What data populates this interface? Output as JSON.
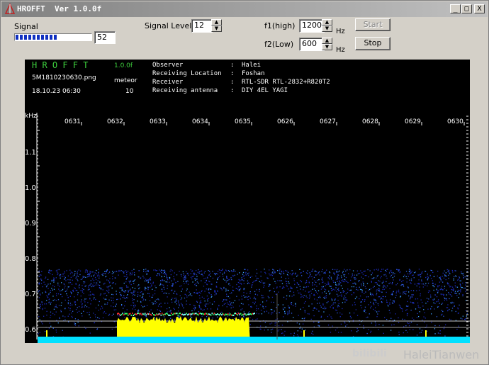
{
  "window": {
    "title": "HROFFT  Ver 1.0.0f",
    "min": "_",
    "max": "□",
    "close": "X"
  },
  "controls": {
    "signal_label": "Signal",
    "signal_value": "52",
    "signal_level": 0.55,
    "signal_level_label": "Signal Level",
    "signal_level_value": "12",
    "f1_label": "f1(high)",
    "f1_value": "1200",
    "f1_unit": "Hz",
    "f2_label": "f2(Low)",
    "f2_value": "600",
    "f2_unit": "Hz",
    "start_label": "Start",
    "stop_label": "Stop"
  },
  "display": {
    "app_name": "H R O F F T",
    "version": "1.0.0f",
    "filename": "5M1810230630.png",
    "mode": "meteor",
    "datetime": "18.10.23 06:30",
    "count": "10",
    "info": [
      {
        "k": "Observer",
        "v": "Halei"
      },
      {
        "k": "Receiving Location",
        "v": "Foshan"
      },
      {
        "k": "Receiver",
        "v": "RTL-SDR RTL-2832+R820T2"
      },
      {
        "k": "Receiving antenna",
        "v": "DIY 4EL YAGI"
      }
    ],
    "time_labels": [
      "0631",
      "0632",
      "0633",
      "0634",
      "0635",
      "0626",
      "0627",
      "0628",
      "0629",
      "0630"
    ],
    "y_unit": "kHz",
    "y_labels": [
      "1.1",
      "1.0",
      "0.9",
      "0.8",
      "0.7",
      "0.6"
    ]
  },
  "watermark": {
    "logo": "bilibili",
    "text": "HaleiTianwen"
  },
  "colors": {
    "title_start": "#808080",
    "title_end": "#c0c0c0",
    "green": "#3ed13e",
    "spectrum_yellow": "#ffff00",
    "spectrum_cyan": "#00e0ff"
  }
}
